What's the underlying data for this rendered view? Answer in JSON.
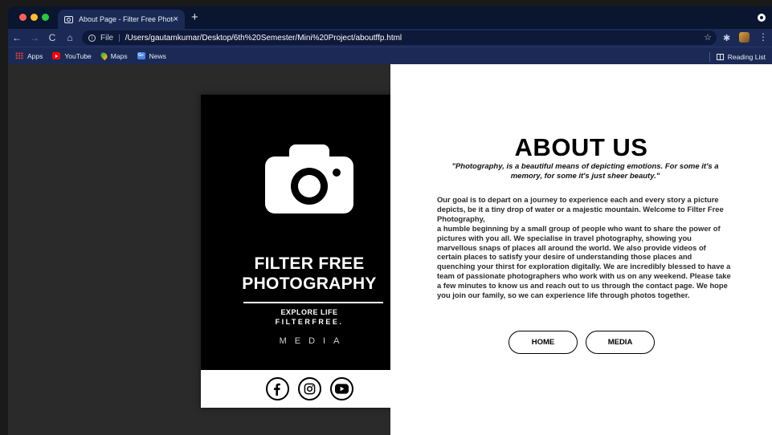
{
  "browser": {
    "tab_title": "About Page - Filter Free Photo",
    "tab_close": "×",
    "new_tab": "+",
    "back": "←",
    "forward": "→",
    "reload": "C",
    "home": "⌂",
    "scheme": "File",
    "separator": "|",
    "url": "/Users/gautamkumar/Desktop/6th%20Semester/Mini%20Project/aboutffp.html",
    "star": "☆",
    "extensions": "✱",
    "menu": "⋮",
    "bookmarks": [
      {
        "label": "Apps",
        "icon": "apps-grid-icon"
      },
      {
        "label": "YouTube",
        "icon": "youtube-icon"
      },
      {
        "label": "Maps",
        "icon": "maps-pin-icon"
      },
      {
        "label": "News",
        "icon": "google-news-icon",
        "badge": "G≡"
      }
    ],
    "reading_list": "Reading List"
  },
  "card": {
    "title_line1": "FILTER FREE",
    "title_line2": "PHOTOGRAPHY",
    "tagline1": "EXPLORE LIFE",
    "tagline2": "FILTERFREE.",
    "media": "MEDIA",
    "social": [
      "facebook-icon",
      "instagram-icon",
      "youtube-icon"
    ]
  },
  "about": {
    "title": "ABOUT US",
    "quote": "\"Photography, is a beautiful means of depicting emotions. For some it's a memory, for some it's just sheer beauty.\"",
    "body_line1": "Our goal is to depart on a journey to experience each and every story a picture depicts, be it a tiny drop of water or a majestic mountain. Welcome to Filter Free Photography,",
    "body_line2": "a humble beginning by a small group of people who want to share the power of pictures with you all. We specialise in travel photography, showing you marvellous snaps of places all around the world. We also provide videos of certain places to satisfy your desire of understanding those places and quenching your thirst for exploration digitally. We are incredibly blessed to have a team of passionate photographers who work with us on any weekend. Please take a few minutes to know us and reach out to us through the contact page. We hope you join our family, so we can experience life through photos together.",
    "buttons": {
      "home": "HOME",
      "media": "MEDIA"
    }
  },
  "colors": {
    "card_bg": "#000000",
    "left_bg": "#2a2a2a",
    "chrome_bg": "#1b2a55",
    "traffic_red": "#ff5f57",
    "traffic_yellow": "#febc2e",
    "traffic_green": "#28c840"
  }
}
